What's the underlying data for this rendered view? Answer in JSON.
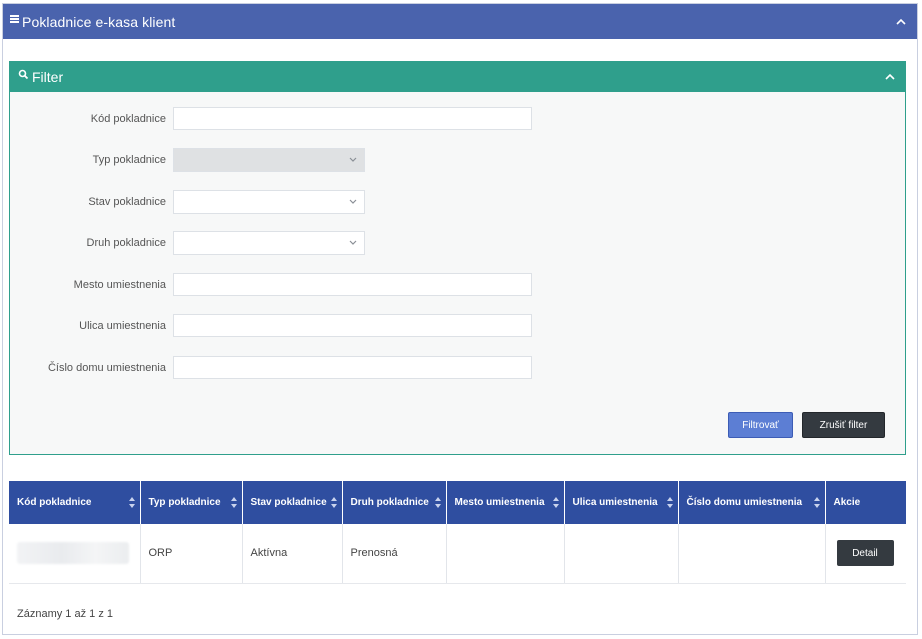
{
  "panel": {
    "title": "Pokladnice e-kasa klient"
  },
  "filter": {
    "title": "Filter",
    "fields": {
      "kod_label": "Kód pokladnice",
      "kod_value": "",
      "typ_label": "Typ pokladnice",
      "typ_value": "",
      "stav_label": "Stav pokladnice",
      "stav_value": "",
      "druh_label": "Druh pokladnice",
      "druh_value": "",
      "mesto_label": "Mesto umiestnenia",
      "mesto_value": "",
      "ulica_label": "Ulica umiestnenia",
      "ulica_value": "",
      "cislo_label": "Číslo domu umiestnenia",
      "cislo_value": ""
    },
    "filter_button": "Filtrovať",
    "reset_button": "Zrušiť filter"
  },
  "table": {
    "columns": [
      "Kód pokladnice",
      "Typ pokladnice",
      "Stav pokladnice",
      "Druh pokladnice",
      "Mesto umiestnenia",
      "Ulica umiestnenia",
      "Číslo domu umiestnenia",
      "Akcie"
    ],
    "rows": [
      {
        "typ": "ORP",
        "stav": "Aktívna",
        "druh": "Prenosná",
        "mesto": "",
        "ulica": "",
        "cislo": "",
        "action": "Detail"
      }
    ]
  },
  "footer": {
    "records": "Záznamy 1 až 1 z 1"
  },
  "colors": {
    "panel_header": "#4a63ad",
    "filter_header": "#2f9f8c",
    "table_header": "#2f4ea0",
    "primary_button": "#5c7ed4",
    "dark_button": "#343a40"
  },
  "icons": {
    "panel_menu": "menu-icon",
    "panel_collapse": "chevron-up-icon",
    "filter_search": "search-icon",
    "filter_collapse": "chevron-up-icon",
    "select_caret": "chevron-down-icon",
    "column_sort": "sort-icon"
  }
}
